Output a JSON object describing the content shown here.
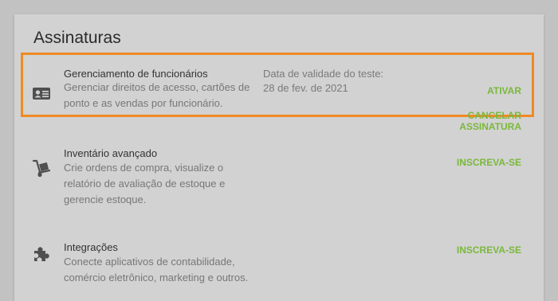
{
  "page": {
    "title": "Assinaturas"
  },
  "subscriptions": [
    {
      "icon": "id-card-icon",
      "name": "Gerenciamento de funcionários",
      "description": "Gerenciar direitos de acesso, cartões de ponto e as vendas por funcionário.",
      "trial_label": "Data de validade do teste:",
      "trial_date": "28 de fev. de 2021",
      "actions": [
        "ATIVAR",
        "CANCELAR ASSINATURA"
      ]
    },
    {
      "icon": "hand-truck-icon",
      "name": "Inventário avançado",
      "description": "Crie ordens de compra, visualize o relatório de avaliação de estoque e gerencie estoque.",
      "actions": [
        "INSCREVA-SE"
      ]
    },
    {
      "icon": "puzzle-piece-icon",
      "name": "Integrações",
      "description": "Conecte aplicativos de contabilidade, comércio eletrônico, marketing e outros.",
      "actions": [
        "INSCREVA-SE"
      ]
    }
  ],
  "colors": {
    "accent": "#7ab83c",
    "highlight_border": "#f08a24",
    "card_background": "#d2d2d2",
    "page_background": "#c2c2c2"
  }
}
